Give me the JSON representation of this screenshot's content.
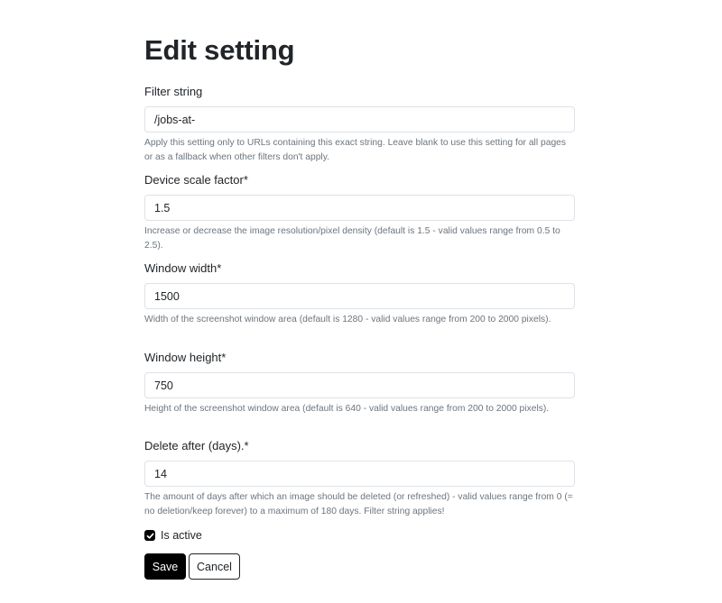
{
  "page": {
    "title": "Edit setting"
  },
  "fields": [
    {
      "label": "Filter string",
      "value": "/jobs-at-",
      "help": "Apply this setting only to URLs containing this exact string. Leave blank to use this setting for all pages or as a fallback when other filters don't apply."
    },
    {
      "label": "Device scale factor*",
      "value": "1.5",
      "help": "Increase or decrease the image resolution/pixel density (default is 1.5 - valid values range from 0.5 to 2.5)."
    },
    {
      "label": "Window width*",
      "value": "1500",
      "help": "Width of the screenshot window area (default is 1280 - valid values range from 200 to 2000 pixels)."
    },
    {
      "label": "Window height*",
      "value": "750",
      "help": "Height of the screenshot window area (default is 640 - valid values range from 200 to 2000 pixels)."
    },
    {
      "label": "Delete after (days).*",
      "value": "14",
      "help": "The amount of days after which an image should be deleted (or refreshed) - valid values range from 0 (= no deletion/keep forever) to a maximum of 180 days. Filter string applies!"
    }
  ],
  "active": {
    "label": "Is active",
    "checked": true
  },
  "actions": {
    "save_label": "Save",
    "cancel_label": "Cancel"
  }
}
